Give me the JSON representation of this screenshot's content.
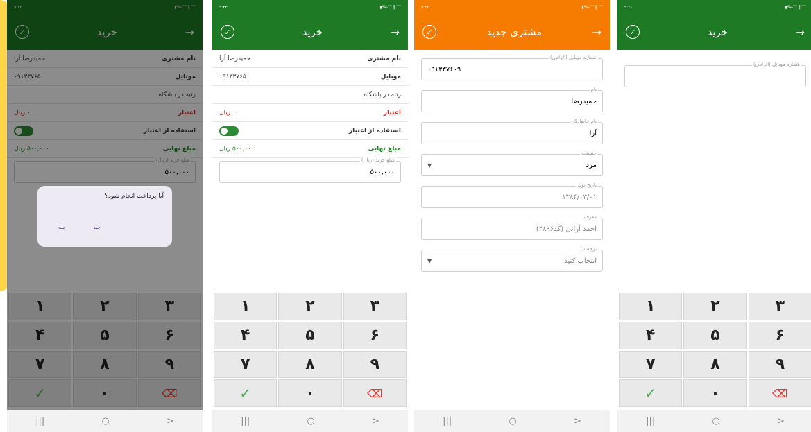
{
  "status": {
    "left_text": "▮‰‷‷ ‖ ‷‷",
    "time1": "۹:۲۳",
    "time2": "۹:۲۳",
    "time3": "۹:۲۳",
    "time4": "۹:۲۰"
  },
  "purchase": {
    "title": "خرید",
    "customer_label": "نام مشتری",
    "customer_value": "حمیدرضا آرا",
    "mobile_label": "موبایل",
    "mobile_value": "۰۹۱۳۳۷۶۵",
    "rank_label": "رتبه در باشگاه",
    "credit_label": "اعتبار",
    "credit_value": "۰ ریال",
    "use_credit_label": "استفاده از اعتبار",
    "final_label": "مبلغ نهایی",
    "final_value": "۵۰۰,۰۰۰ ریال",
    "amount_legend": "مبلغ خرید (ریال)",
    "amount_value": "۵۰۰,۰۰۰"
  },
  "dialog": {
    "question": "آیا پرداخت انجام شود؟",
    "no": "خیر",
    "yes": "بله"
  },
  "new_customer": {
    "title": "مشتری جدید",
    "mobile_legend": "شماره موبایل (الزامی)",
    "mobile_value": "۰۹۱۳۳۷۶۰۹",
    "name_legend": "نام",
    "name_value": "حمیدرضا",
    "family_legend": "نام خانوادگی",
    "family_value": "آرا",
    "gender_legend": "جنسیت",
    "gender_value": "مرد",
    "birth_legend": "تاریخ تولد",
    "birth_value": "۱۳۸۴/۰۳/۰۱",
    "referrer_legend": "معرف",
    "referrer_value": "احمد آرانی (کد۲۸۹۶)",
    "tag_legend": "برچسب",
    "tag_value": "انتخاب کنید"
  },
  "search": {
    "title": "خرید",
    "mobile_legend": "شماره موبایل (الزامی)"
  },
  "keypad": {
    "k1": "۱",
    "k2": "۲",
    "k3": "۳",
    "k4": "۴",
    "k5": "۵",
    "k6": "۶",
    "k7": "۷",
    "k8": "۸",
    "k9": "۹",
    "k0": "۰",
    "ok": "✓",
    "del": "⌫"
  },
  "nav": {
    "recent": "|||",
    "home": "○",
    "back": ">"
  },
  "colors": {
    "green": "#1e7a24",
    "orange": "#f57c00",
    "accent_yellow": "#ffd54a"
  }
}
